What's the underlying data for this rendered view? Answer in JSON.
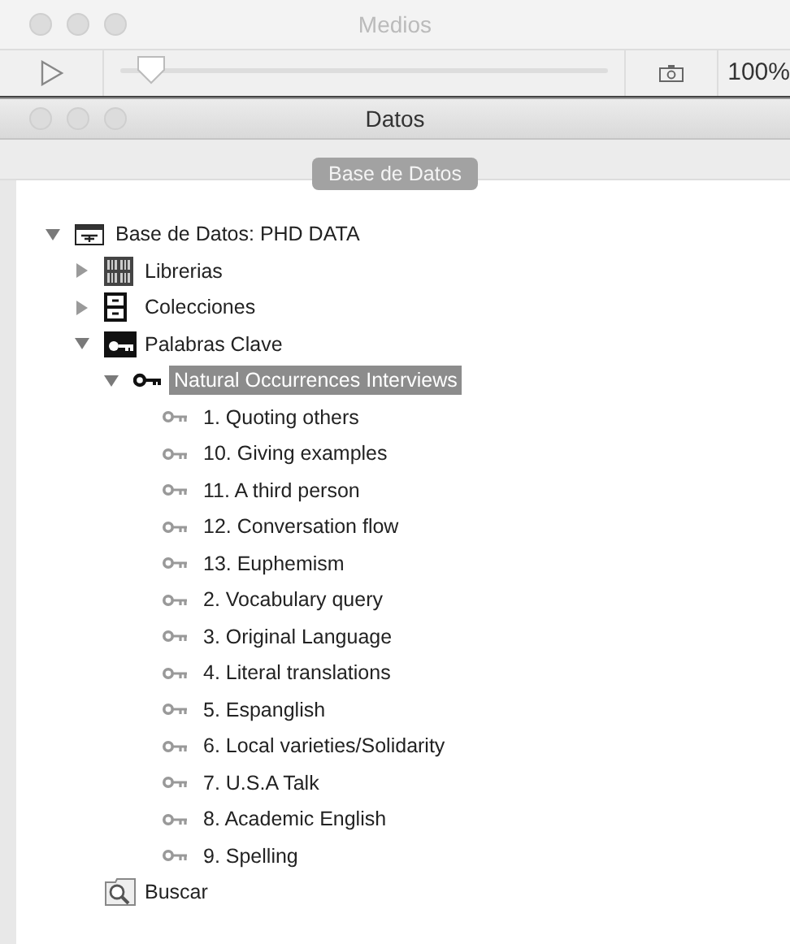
{
  "media_window": {
    "title": "Medios",
    "position": {
      "level": 0.03
    },
    "zoom": "100%"
  },
  "data_window": {
    "title": "Datos",
    "tabs": [
      {
        "label": "Base de Datos",
        "selected": true
      }
    ],
    "tree": [
      {
        "label": "Base de Datos: PHD DATA",
        "kind": "database",
        "expanded": true,
        "selected": false,
        "children": [
          {
            "label": "Librerias",
            "kind": "library",
            "expanded": false,
            "selected": false
          },
          {
            "label": "Colecciones",
            "kind": "collection",
            "expanded": false,
            "selected": false
          },
          {
            "label": "Palabras Clave",
            "kind": "keywords",
            "expanded": true,
            "selected": false,
            "children": [
              {
                "label": "Natural Occurrences Interviews",
                "kind": "group",
                "expanded": true,
                "selected": true,
                "children": [
                  {
                    "label": "1. Quoting others",
                    "kind": "keyword",
                    "selected": false
                  },
                  {
                    "label": "10. Giving examples",
                    "kind": "keyword",
                    "selected": false
                  },
                  {
                    "label": "11. A third person",
                    "kind": "keyword",
                    "selected": false
                  },
                  {
                    "label": "12. Conversation flow",
                    "kind": "keyword",
                    "selected": false
                  },
                  {
                    "label": "13. Euphemism",
                    "kind": "keyword",
                    "selected": false
                  },
                  {
                    "label": "2. Vocabulary query",
                    "kind": "keyword",
                    "selected": false
                  },
                  {
                    "label": "3. Original Language",
                    "kind": "keyword",
                    "selected": false
                  },
                  {
                    "label": "4. Literal translations",
                    "kind": "keyword",
                    "selected": false
                  },
                  {
                    "label": "5. Espanglish",
                    "kind": "keyword",
                    "selected": false
                  },
                  {
                    "label": "6. Local varieties/Solidarity",
                    "kind": "keyword",
                    "selected": false
                  },
                  {
                    "label": "7. U.S.A Talk",
                    "kind": "keyword",
                    "selected": false
                  },
                  {
                    "label": "8. Academic English",
                    "kind": "keyword",
                    "selected": false
                  },
                  {
                    "label": "9. Spelling",
                    "kind": "keyword",
                    "selected": false
                  }
                ]
              }
            ]
          },
          {
            "label": "Buscar",
            "kind": "search",
            "selected": false
          }
        ]
      }
    ]
  }
}
